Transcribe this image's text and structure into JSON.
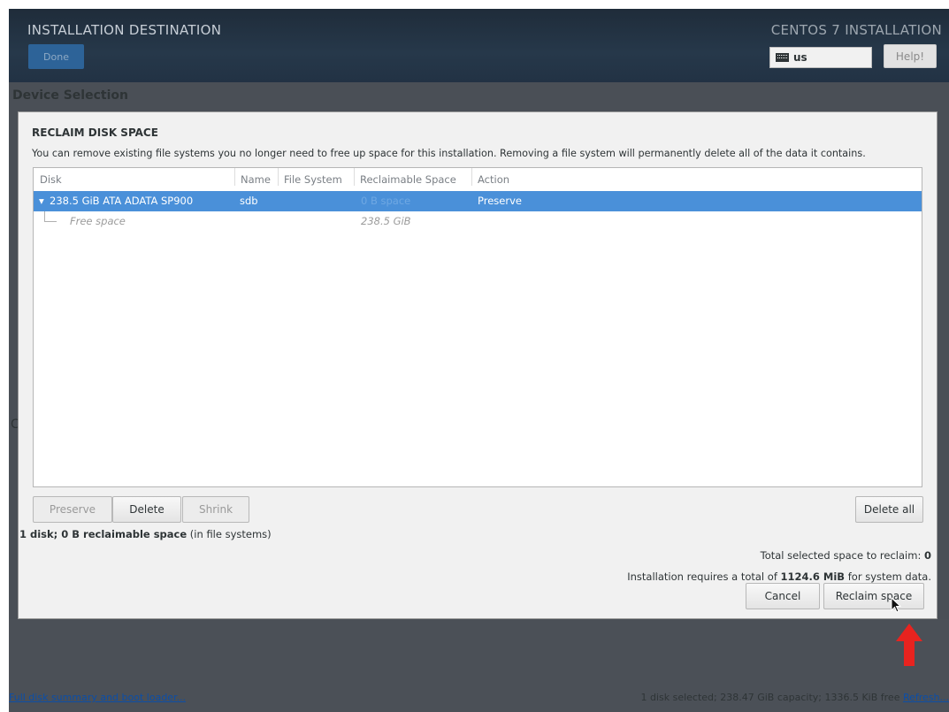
{
  "header": {
    "title": "INSTALLATION DESTINATION",
    "done_label": "Done",
    "product": "CENTOS 7 INSTALLATION",
    "keyboard_layout": "us",
    "help_label": "Help!"
  },
  "section_title": "Device Selection",
  "stray_letter": "C",
  "dialog": {
    "title": "RECLAIM DISK SPACE",
    "description": "You can remove existing file systems you no longer need to free up space for this installation.  Removing a file system will permanently delete all of the data it contains.",
    "columns": [
      "Disk",
      "Name",
      "File System",
      "Reclaimable Space",
      "Action"
    ],
    "rows": [
      {
        "disk": "238.5 GiB ATA ADATA SP900",
        "name": "sdb",
        "fs": "",
        "reclaimable": "0 B space",
        "action": "Preserve"
      },
      {
        "disk": "Free space",
        "name": "",
        "fs": "",
        "reclaimable": "238.5 GiB",
        "action": ""
      }
    ],
    "buttons": {
      "preserve": "Preserve",
      "delete": "Delete",
      "shrink": "Shrink",
      "delete_all": "Delete all",
      "cancel": "Cancel",
      "reclaim": "Reclaim space"
    },
    "summary_bold": "1 disk; 0 B reclaimable space",
    "summary_rest": " (in file systems)",
    "total_label": "Total selected space to reclaim: ",
    "total_value": "0",
    "req_prefix": "Installation requires a total of ",
    "req_value": "1124.6 MiB",
    "req_suffix": " for system data."
  },
  "footer": {
    "link": "Full disk summary and boot loader...",
    "status": "1 disk selected; 238.47 GiB capacity; 1336.5 KiB free ",
    "refresh": "Refresh..."
  },
  "colors": {
    "selection": "#4a90d9",
    "header_bg": "#223244",
    "done_button": "#2d6398",
    "annotation_arrow": "#e8231f"
  }
}
